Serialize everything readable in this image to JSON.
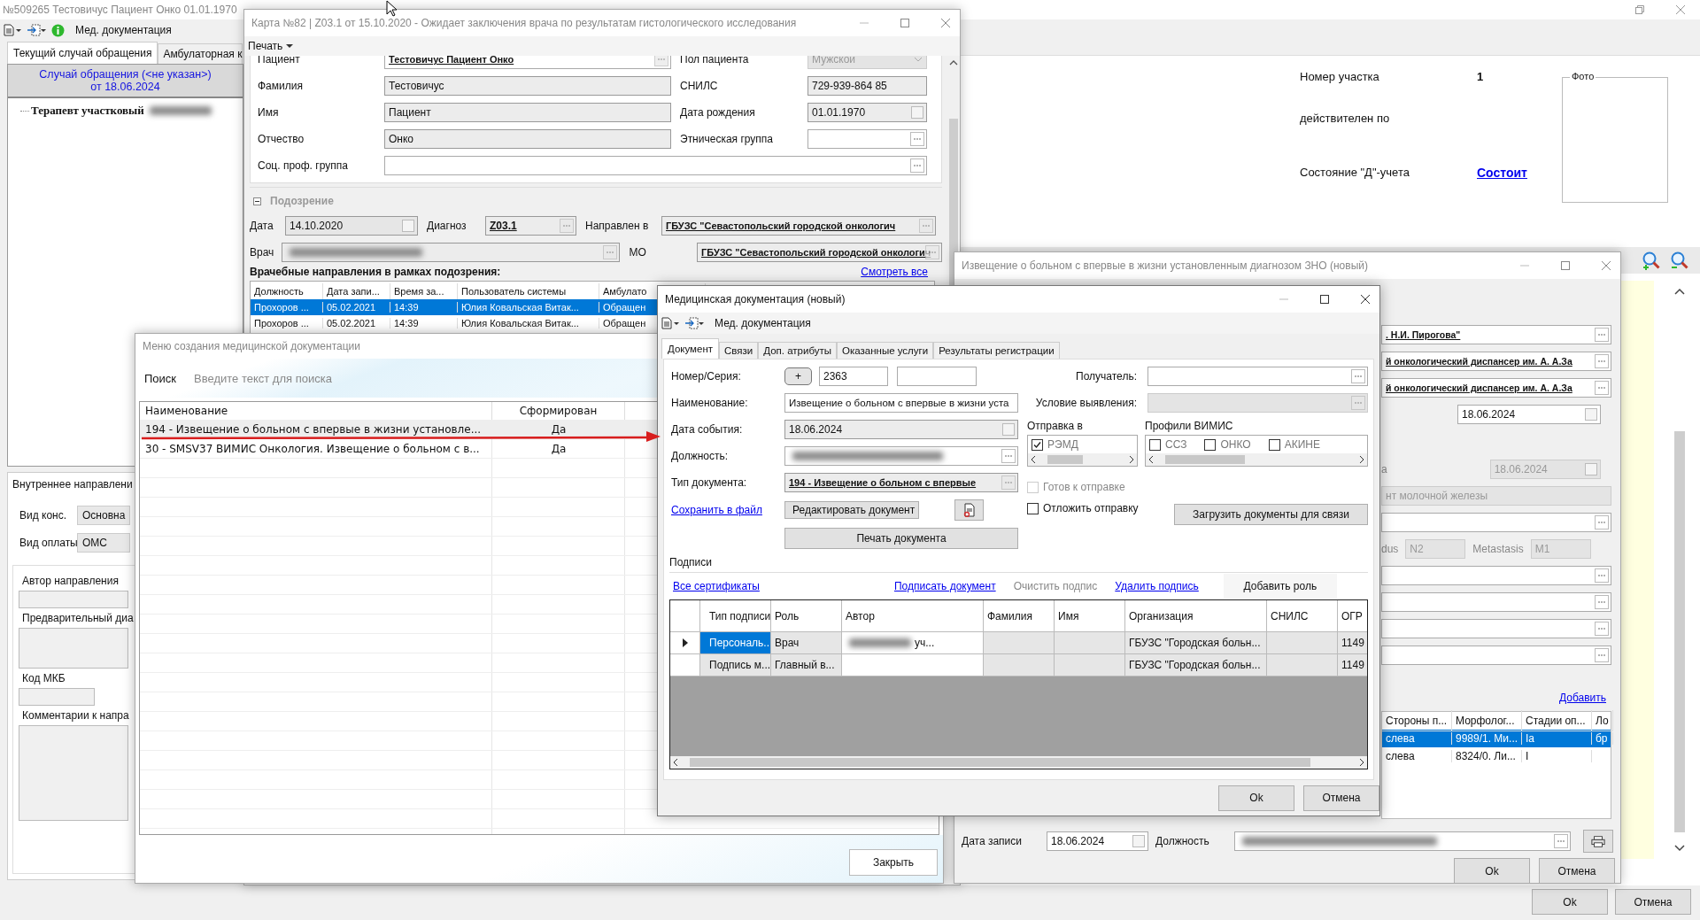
{
  "main_window": {
    "title": "№509265 Тестовичус Пациент Онко 01.01.1970",
    "toolbar_label": "Мед. документация",
    "tabs": [
      {
        "label": "Текущий случай обращения",
        "selected": true
      },
      {
        "label": "Амбулаторная к",
        "selected": false
      }
    ],
    "case_title": "Случай обращения (<не указан>)",
    "case_date": "от 18.06.2024",
    "tree": [
      {
        "label": "Терапевт участковый"
      }
    ],
    "referral_title": "Внутреннее направлени",
    "referral_fields": [
      {
        "label": "Вид конс.",
        "value": "Основна"
      },
      {
        "label": "Вид оплаты",
        "value": "ОМС"
      }
    ],
    "referral_boxes": [
      {
        "label": "Автор направления",
        "kind": "line"
      },
      {
        "label": "Предварительный диа",
        "kind": "area"
      },
      {
        "label": "Код МКБ",
        "kind": "short"
      },
      {
        "label": "Комментарии к напра",
        "kind": "tall"
      }
    ],
    "info": [
      {
        "label": "Номер участка",
        "value": "1"
      },
      {
        "label": "действителен по"
      },
      {
        "label": "Состояние \"Д\"-учета",
        "link": "Состоит"
      }
    ],
    "photo_label": "Фото",
    "buttons": [
      "Ok",
      "Отмена"
    ]
  },
  "card_window": {
    "title": "Карта №82 | Z03.1 от 15.10.2020 - Ожидает заключения врача по результатам гистологического исследования",
    "menu": "Печать",
    "left_fields": [
      {
        "label": "Пациент",
        "value": "Тестовичус Пациент Онко",
        "kind": "link"
      },
      {
        "label": "Фамилия",
        "value": "Тестовичус",
        "kind": "text"
      },
      {
        "label": "Имя",
        "value": "Пациент",
        "kind": "text"
      },
      {
        "label": "Отчество",
        "value": "Онко",
        "kind": "text"
      }
    ],
    "right_fields": [
      {
        "label": "Пол пациента",
        "value": "Мужской",
        "kind": "combo"
      },
      {
        "label": "СНИЛС",
        "value": "729-939-864 85",
        "kind": "text"
      },
      {
        "label": "Дата рождения",
        "value": "01.01.1970",
        "kind": "date"
      },
      {
        "label": "Этническая группа",
        "kind": "lookup"
      }
    ],
    "wide_field": {
      "label": "Соц. проф. группа"
    },
    "section": {
      "title": "Подозрение",
      "expanded": true
    },
    "date": {
      "label": "Дата",
      "value": "14.10.2020"
    },
    "diagnosis": {
      "label": "Диагноз",
      "value": "Z03.1"
    },
    "directed": {
      "label": "Направлен в",
      "value": "ГБУЗС \"Севастопольский городской онкологич"
    },
    "doctor": {
      "label": "Врач"
    },
    "mo": {
      "label": "МО",
      "value": "ГБУЗС \"Севастопольский городской онкологич"
    },
    "referrals": {
      "title": "Врачебные направления в рамках подозрения:",
      "link": "Смотреть все",
      "columns": [
        "Должность",
        "Дата запи...",
        "Время за...",
        "Пользователь системы",
        "Амбулато"
      ],
      "rows": [
        {
          "cells": [
            "Прохоров ...",
            "05.02.2021",
            "14:39",
            "Юлия Ковальская Витак...",
            "Обращен"
          ],
          "selected": true
        },
        {
          "cells": [
            "Прохоров ...",
            "05.02.2021",
            "14:39",
            "Юлия Ковальская Витак...",
            "Обращен"
          ],
          "selected": false
        }
      ]
    }
  },
  "menu_window": {
    "title": "Меню создания медицинской документации",
    "search_label": "Поиск",
    "search_placeholder": "Введите текст для поиска",
    "columns": [
      "Наименование",
      "Сформирован"
    ],
    "rows": [
      {
        "cells": [
          "194 - Извещение о больном с впервые в жизни установле...",
          "Да"
        ],
        "selected": true
      },
      {
        "cells": [
          "30 - SMSV37 ВИМИС Онкология. Извещение о больном с в...",
          "Да"
        ],
        "selected": false
      }
    ],
    "close_button": "Закрыть"
  },
  "notice_window": {
    "title": "Извещение о больном с впервые в жизни установленным диагнозом ЗНО (новый)",
    "fields": [
      {
        "kind": "link",
        "value": ". Н.И. Пирогова\""
      },
      {
        "kind": "link",
        "value": "й онкологический диспансер им. А. А.За"
      },
      {
        "kind": "link",
        "value": "й онкологический диспансер им. А. А.За"
      },
      {
        "kind": "date",
        "value": "18.06.2024"
      },
      {
        "kind": "date_disabled",
        "label": "а",
        "value": "18.06.2024"
      },
      {
        "kind": "readonly",
        "value": "нт молочной железы"
      },
      {
        "kind": "lookup"
      },
      {
        "kind": "tnm",
        "parts": [
          {
            "label": "dus",
            "value": "N2"
          },
          {
            "label": "Metastasis",
            "value": "M1"
          }
        ]
      },
      {
        "kind": "lookup"
      },
      {
        "kind": "lookup"
      },
      {
        "kind": "lookup"
      },
      {
        "kind": "lookup"
      }
    ],
    "add_link": "Добавить",
    "table": {
      "columns": [
        "Стороны п...",
        "Морфолог...",
        "Стадии оп...",
        "Ло"
      ],
      "rows": [
        {
          "cells": [
            "слева",
            "9989/1. Ми...",
            "Ia",
            "бр"
          ],
          "selected": true
        },
        {
          "cells": [
            "слева",
            "8324/0. Ли...",
            "I"
          ],
          "selected": false
        }
      ]
    },
    "record_date": {
      "label": "Дата записи",
      "value": "18.06.2024"
    },
    "position_label": "Должность",
    "buttons": [
      "Ok",
      "Отмена"
    ]
  },
  "doc_window": {
    "title": "Медицинская документация (новый)",
    "toolbar_label": "Мед. документация",
    "tabs": [
      {
        "label": "Документ",
        "selected": true
      },
      {
        "label": "Связи",
        "selected": false
      },
      {
        "label": "Доп. атрибуты",
        "selected": false
      },
      {
        "label": "Оказанные услуги",
        "selected": false
      },
      {
        "label": "Результаты регистрации",
        "selected": false
      }
    ],
    "number": {
      "label": "Номер/Серия:",
      "add": "+",
      "value": "2363"
    },
    "name": {
      "label": "Наименование:",
      "value": "Извещение о больном с впервые в жизни уста"
    },
    "event_date": {
      "label": "Дата события:",
      "value": "18.06.2024"
    },
    "position": {
      "label": "Должность:"
    },
    "doc_type": {
      "label": "Тип документа:",
      "value": "194 - Извещение о больном с впервые"
    },
    "save_link": "Сохранить в файл",
    "edit_button": "Редактировать документ",
    "print_button": "Печать документа",
    "recipient": {
      "label": "Получатель:"
    },
    "detection": {
      "label": "Условие выявления:"
    },
    "send_to": {
      "title": "Отправка в",
      "options": [
        {
          "label": "РЭМД",
          "checked": true
        }
      ]
    },
    "profiles": {
      "title": "Профили ВИМИС",
      "options": [
        {
          "label": "ССЗ",
          "checked": false
        },
        {
          "label": "ОНКО",
          "checked": false
        },
        {
          "label": "АКИНЕ",
          "checked": false
        }
      ]
    },
    "flags": [
      {
        "label": "Готов к отправке",
        "checked": false,
        "disabled": true
      },
      {
        "label": "Отложить отправку",
        "checked": false,
        "disabled": false
      }
    ],
    "load_button": "Загрузить документы для связи",
    "signatures": {
      "title": "Подписи",
      "actions": [
        {
          "label": "Все сертификаты",
          "kind": "link"
        },
        {
          "label": "Подписать документ",
          "kind": "link"
        },
        {
          "label": "Очистить подпис",
          "kind": "disabled"
        },
        {
          "label": "Удалить подпись",
          "kind": "link"
        },
        {
          "label": "Добавить роль",
          "kind": "button"
        }
      ],
      "columns": [
        "Тип подписи",
        "Роль",
        "Автор",
        "Фамилия",
        "Имя",
        "Организация",
        "СНИЛС",
        "ОГР"
      ],
      "rows": [
        {
          "selected": true,
          "type": "Персональ...",
          "role": "Врач",
          "author": "уч...",
          "organization": "ГБУЗС \"Городская больн...",
          "ogrn": "1149"
        },
        {
          "selected": false,
          "type": "Подпись м...",
          "role": "Главный в...",
          "organization": "ГБУЗС \"Городская больн...",
          "ogrn": "1149"
        }
      ]
    },
    "buttons": [
      "Ok",
      "Отмена"
    ]
  }
}
